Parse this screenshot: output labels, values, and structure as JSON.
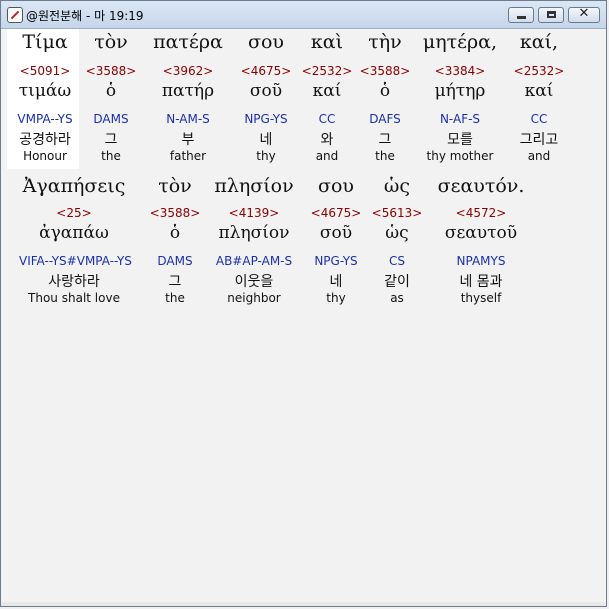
{
  "window": {
    "title": "@원전분해 - 마 19:19"
  },
  "rows": [
    [
      {
        "greek": "Τίμα",
        "strong": "<5091>",
        "lemma": "τιμάω",
        "code": "VMPA--YS",
        "korean": "공경하라",
        "english": "Honour"
      },
      {
        "greek": "τὸν",
        "strong": "<3588>",
        "lemma": "ὁ",
        "code": "DAMS",
        "korean": "그",
        "english": "the"
      },
      {
        "greek": "πατέρα",
        "strong": "<3962>",
        "lemma": "πατήρ",
        "code": "N-AM-S",
        "korean": "부",
        "english": "father"
      },
      {
        "greek": "σου",
        "strong": "<4675>",
        "lemma": "σοῦ",
        "code": "NPG-YS",
        "korean": "네",
        "english": "thy"
      },
      {
        "greek": "καὶ",
        "strong": "<2532>",
        "lemma": "καί",
        "code": "CC",
        "korean": "와",
        "english": "and"
      },
      {
        "greek": "τὴν",
        "strong": "<3588>",
        "lemma": "ὁ",
        "code": "DAFS",
        "korean": "그",
        "english": "the"
      },
      {
        "greek": "μητέρα,",
        "strong": "<3384>",
        "lemma": "μήτηρ",
        "code": "N-AF-S",
        "korean": "모를",
        "english": "thy mother"
      },
      {
        "greek": "καί,",
        "strong": "<2532>",
        "lemma": "καί",
        "code": "CC",
        "korean": "그리고",
        "english": "and"
      }
    ],
    [
      {
        "greek": "Ἀγαπήσεις",
        "strong": "<25>",
        "lemma": "ἀγαπάω",
        "code": "VIFA--YS#VMPA--YS",
        "korean": "사랑하라",
        "english": "Thou shalt love"
      },
      {
        "greek": "τὸν",
        "strong": "<3588>",
        "lemma": "ὁ",
        "code": "DAMS",
        "korean": "그",
        "english": "the"
      },
      {
        "greek": "πλησίον",
        "strong": "<4139>",
        "lemma": "πλησίον",
        "code": "AB#AP-AM-S",
        "korean": "이웃을",
        "english": "neighbor"
      },
      {
        "greek": "σου",
        "strong": "<4675>",
        "lemma": "σοῦ",
        "code": "NPG-YS",
        "korean": "네",
        "english": "thy"
      },
      {
        "greek": "ὡς",
        "strong": "<5613>",
        "lemma": "ὡς",
        "code": "CS",
        "korean": "같이",
        "english": "as"
      },
      {
        "greek": "σεαυτόν.",
        "strong": "<4572>",
        "lemma": "σεαυτοῦ",
        "code": "NPAMYS",
        "korean": "네 몸과",
        "english": "thyself"
      }
    ]
  ]
}
